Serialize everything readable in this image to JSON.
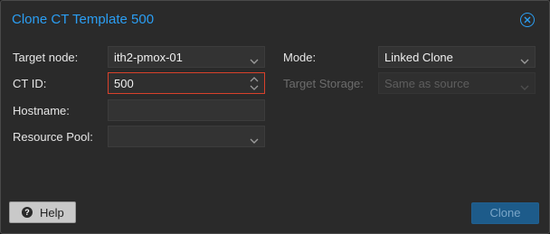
{
  "dialog": {
    "title": "Clone CT Template 500"
  },
  "form": {
    "target_node": {
      "label": "Target node:",
      "value": "ith2-pmox-01"
    },
    "ct_id": {
      "label": "CT ID:",
      "value": "500"
    },
    "hostname": {
      "label": "Hostname:",
      "value": ""
    },
    "resource_pool": {
      "label": "Resource Pool:",
      "value": ""
    },
    "mode": {
      "label": "Mode:",
      "value": "Linked Clone"
    },
    "target_storage": {
      "label": "Target Storage:",
      "value": "Same as source"
    }
  },
  "footer": {
    "help_label": "Help",
    "help_icon": "?",
    "clone_label": "Clone"
  },
  "colors": {
    "accent": "#2b9ef3",
    "focus_border": "#d9412b",
    "primary_button": "#1d5b8a"
  },
  "icons": {
    "close": "close-circle-icon",
    "dropdown": "chevron-down-icon",
    "spinner": "spinner-arrows-icon",
    "help": "question-circle-icon"
  }
}
